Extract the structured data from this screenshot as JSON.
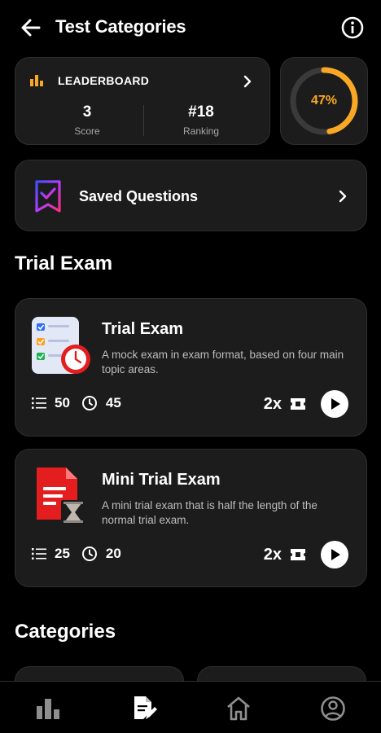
{
  "header": {
    "title": "Test Categories"
  },
  "leaderboard": {
    "label": "LEADERBOARD",
    "score_value": "3",
    "score_label": "Score",
    "ranking_value": "#18",
    "ranking_label": "Ranking"
  },
  "progress": {
    "percent": 47,
    "text": "47%"
  },
  "saved": {
    "label": "Saved Questions"
  },
  "sections": {
    "trial_exam": "Trial Exam",
    "categories": "Categories"
  },
  "exams": [
    {
      "title": "Trial Exam",
      "description": "A mock exam in exam format, based on four main topic areas.",
      "questions": "50",
      "minutes": "45",
      "tickets": "2x"
    },
    {
      "title": "Mini Trial Exam",
      "description": "A mini trial exam that is half the length of the normal trial exam.",
      "questions": "25",
      "minutes": "20",
      "tickets": "2x"
    }
  ],
  "nav": {
    "items": [
      "stats-icon",
      "tests-icon",
      "home-icon",
      "profile-icon"
    ],
    "active": "tests-icon"
  },
  "colors": {
    "accent": "#f9a825",
    "card": "#1c1c1c",
    "background": "#000000"
  }
}
